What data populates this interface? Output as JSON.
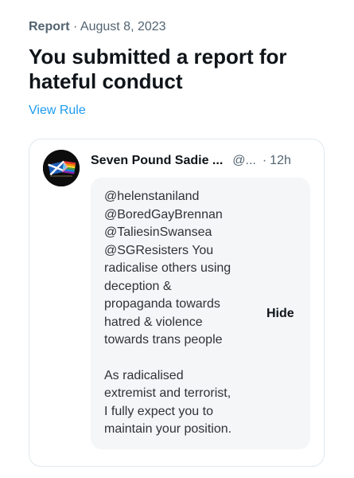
{
  "meta": {
    "label": "Report",
    "separator": "·",
    "date": "August 8, 2023"
  },
  "title": "You submitted a report for hateful conduct",
  "view_rule_label": "View Rule",
  "tweet": {
    "author_name": "Seven Pound Sadie ...",
    "handle": "@...",
    "separator": "·",
    "time": "12h",
    "paragraph_1": "@helenstaniland\n@BoredGayBrennan\n@TaliesinSwansea\n@SGResisters You\nradicalise others using\ndeception &\npropaganda towards\nhatred & violence\ntowards trans people",
    "paragraph_2": "As radicalised\nextremist and terrorist,\nI fully expect you to\nmaintain your position.",
    "hide_label": "Hide",
    "avatar_icon": "flag-avatar-icon"
  },
  "colors": {
    "link": "#1d9bf0",
    "secondary_text": "#536471",
    "primary_text": "#0f1419",
    "hidden_bg": "#f4f6f8",
    "card_border": "#e1e8ed"
  }
}
